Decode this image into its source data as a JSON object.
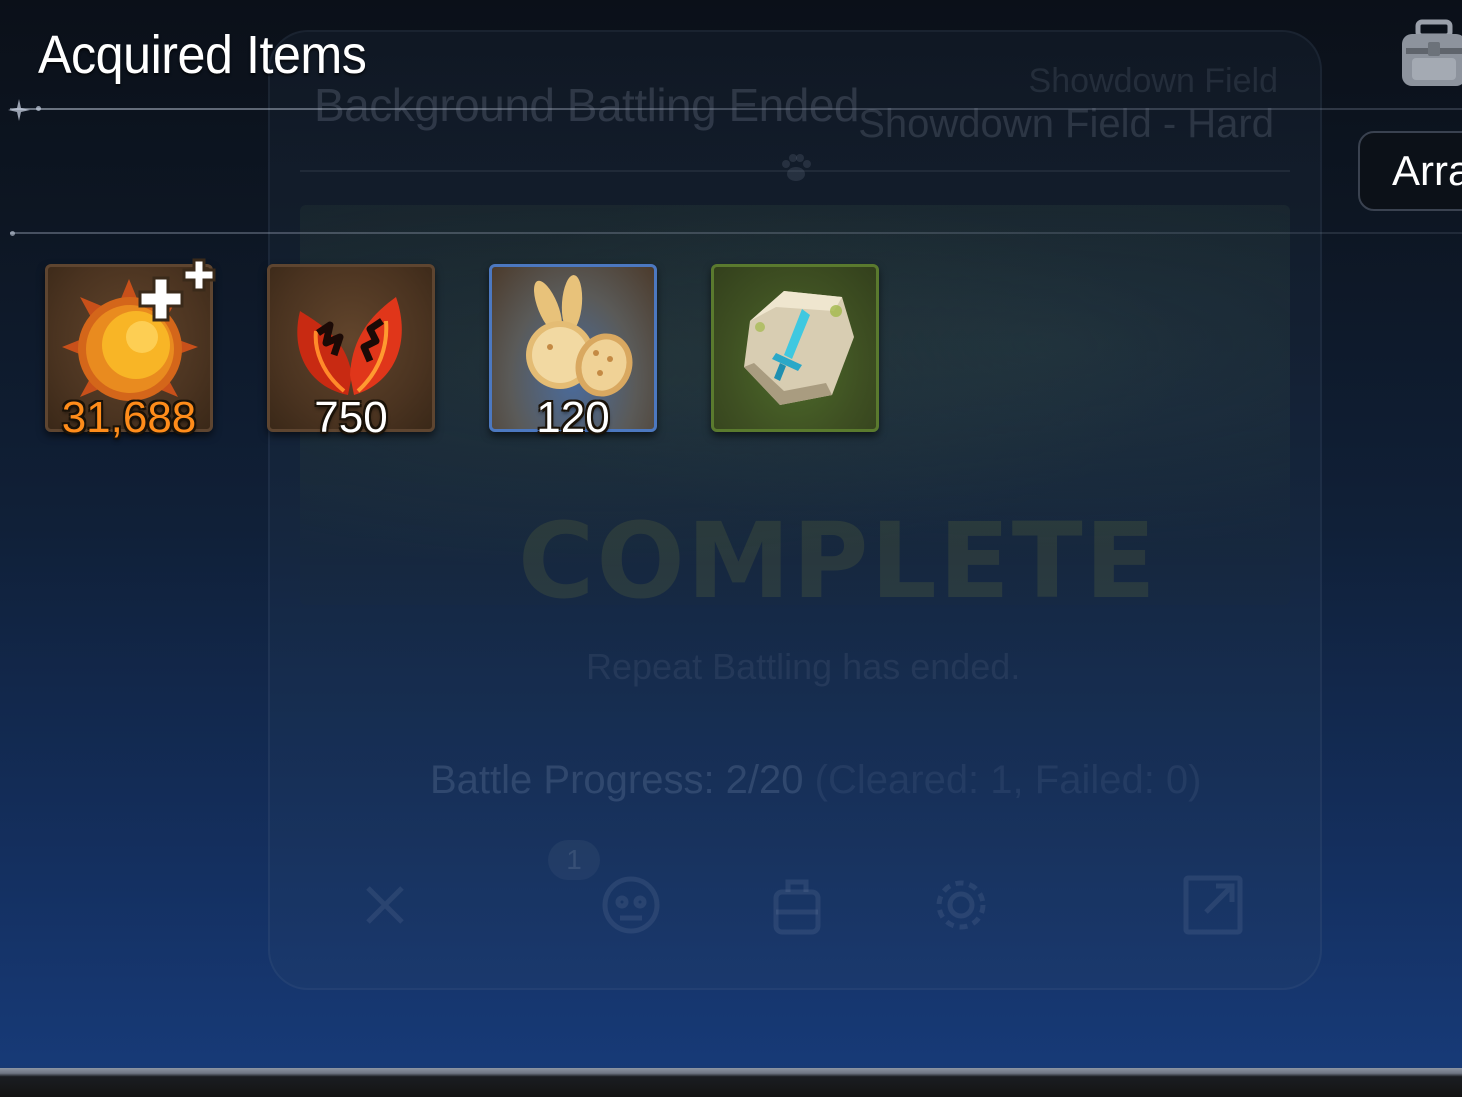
{
  "overlay": {
    "title": "Acquired Items",
    "arrange_label": "Arrange",
    "inventory_icon": "backpack-icon"
  },
  "items": [
    {
      "name": "gold",
      "icon": "sun-coin-icon",
      "count": "31,688",
      "count_color": "#ff8c1a",
      "frame": "brown",
      "bonus_icon": "double-plus-icon"
    },
    {
      "name": "leaf",
      "icon": "red-leaf-icon",
      "count": "750",
      "count_color": "#ffffff",
      "frame": "brown"
    },
    {
      "name": "cookie",
      "icon": "bunny-cookie-icon",
      "count": "120",
      "count_color": "#ffffff",
      "frame": "blue"
    },
    {
      "name": "rune",
      "icon": "sword-rune-stone-icon",
      "count": "",
      "frame": "green"
    }
  ],
  "background_panel": {
    "title": "Background Battling Ended",
    "field_small": "Showdown Field",
    "field": "Showdown Field - Hard",
    "status": "COMPLETE",
    "message": "Repeat Battling has ended.",
    "progress_main": "Battle Progress: 2/20",
    "progress_detail": " (Cleared: 1, Failed: 0)",
    "badge": "1",
    "buttons": [
      "close-icon",
      "monster-icon",
      "backpack-icon",
      "gear-icon",
      "external-link-icon"
    ]
  },
  "colors": {
    "title": "#ffffff",
    "gold_count": "#ff8c1a",
    "background_top": "#0b1019",
    "background_bottom": "#173a77"
  }
}
